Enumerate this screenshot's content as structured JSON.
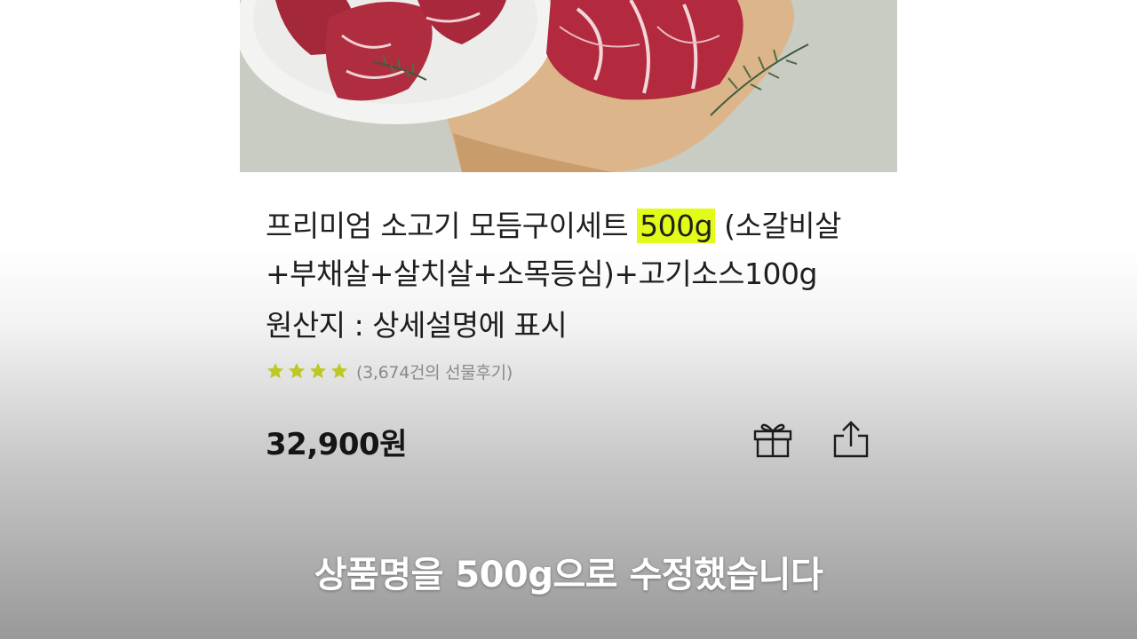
{
  "product": {
    "title_before": "프리미엄 소고기 모듬구이세트 ",
    "title_highlight": "500g",
    "title_after": " (소갈비살+부채살+살치살+소목등심)+고기소스100g",
    "origin": "원산지 : 상세설명에 표시",
    "rating_stars": 4,
    "review_count": "(3,674건의 선물후기)",
    "price": "32,900원"
  },
  "actions": {
    "gift_icon": "gift-icon",
    "share_icon": "share-icon"
  },
  "caption": {
    "text": "상품명을 500g으로 수정했습니다"
  },
  "colors": {
    "highlight": "#e3fb19",
    "star": "#d4e02b"
  }
}
